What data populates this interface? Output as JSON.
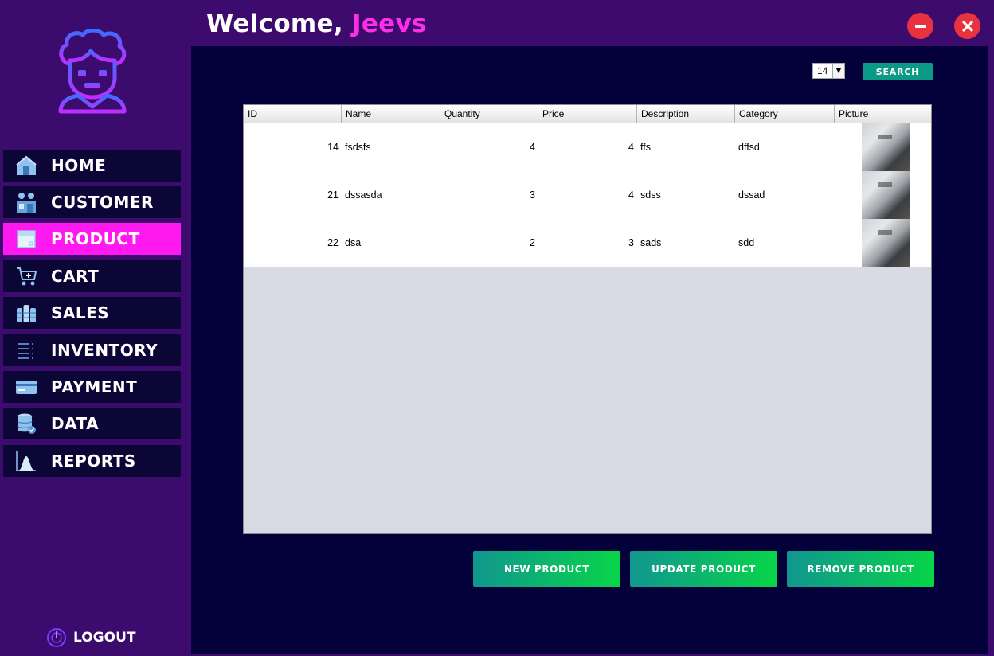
{
  "header": {
    "greeting": "Welcome,",
    "username": "Jeevs"
  },
  "sidebar": {
    "items": [
      {
        "label": "HOME",
        "icon": "home-icon"
      },
      {
        "label": "CUSTOMER",
        "icon": "customer-icon"
      },
      {
        "label": "PRODUCT",
        "icon": "product-box-icon",
        "active": true
      },
      {
        "label": "CART",
        "icon": "cart-icon"
      },
      {
        "label": "SALES",
        "icon": "coins-icon"
      },
      {
        "label": "INVENTORY",
        "icon": "list-icon"
      },
      {
        "label": "PAYMENT",
        "icon": "credit-card-icon"
      },
      {
        "label": "DATA",
        "icon": "database-icon"
      },
      {
        "label": "REPORTS",
        "icon": "chart-icon"
      }
    ],
    "logout_label": "LOGOUT"
  },
  "search": {
    "selected_id": "14",
    "button_label": "SEARCH"
  },
  "table": {
    "columns": [
      "ID",
      "Name",
      "Quantity",
      "Price",
      "Description",
      "Category",
      "Picture"
    ],
    "rows": [
      {
        "id": "14",
        "name": "fsdsfs",
        "quantity": "4",
        "price": "4",
        "description": "ffs",
        "category": "dffsd"
      },
      {
        "id": "21",
        "name": "dssasda",
        "quantity": "3",
        "price": "4",
        "description": "sdss",
        "category": "dssad"
      },
      {
        "id": "22",
        "name": "dsa",
        "quantity": "2",
        "price": "3",
        "description": "sads",
        "category": "sdd"
      }
    ]
  },
  "actions": {
    "new_label": "NEW PRODUCT",
    "update_label": "UPDATE PRODUCT",
    "remove_label": "REMOVE PRODUCT"
  },
  "colors": {
    "sidebar_bg": "#3b0c6e",
    "main_bg": "#03003a",
    "nav_bg": "#0c0636",
    "active_accent": "#ff19f0",
    "username_color": "#ff2ee8",
    "search_button": "#0a9a86",
    "window_buttons": "#e8333e"
  }
}
